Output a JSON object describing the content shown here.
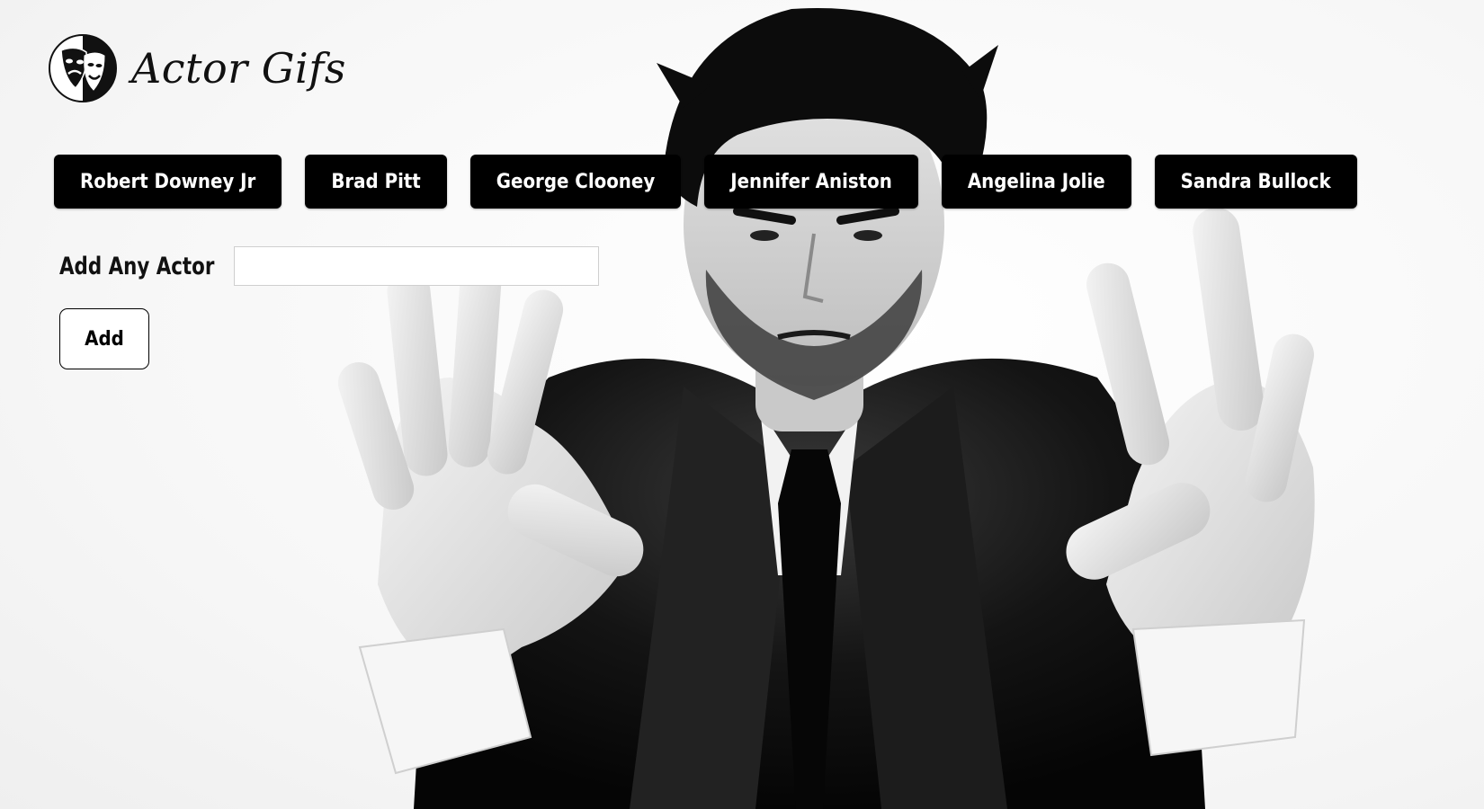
{
  "app": {
    "title": "Actor Gifs",
    "logo_icon": "theater-masks-icon"
  },
  "actors": [
    {
      "label": "Robert Downey Jr"
    },
    {
      "label": "Brad Pitt"
    },
    {
      "label": "George Clooney"
    },
    {
      "label": "Jennifer Aniston"
    },
    {
      "label": "Angelina Jolie"
    },
    {
      "label": "Sandra Bullock"
    }
  ],
  "add_form": {
    "label": "Add Any Actor",
    "input_value": "",
    "input_placeholder": "",
    "button_label": "Add"
  },
  "colors": {
    "button_bg": "#000000",
    "button_text": "#ffffff",
    "page_bg": "#ffffff"
  }
}
